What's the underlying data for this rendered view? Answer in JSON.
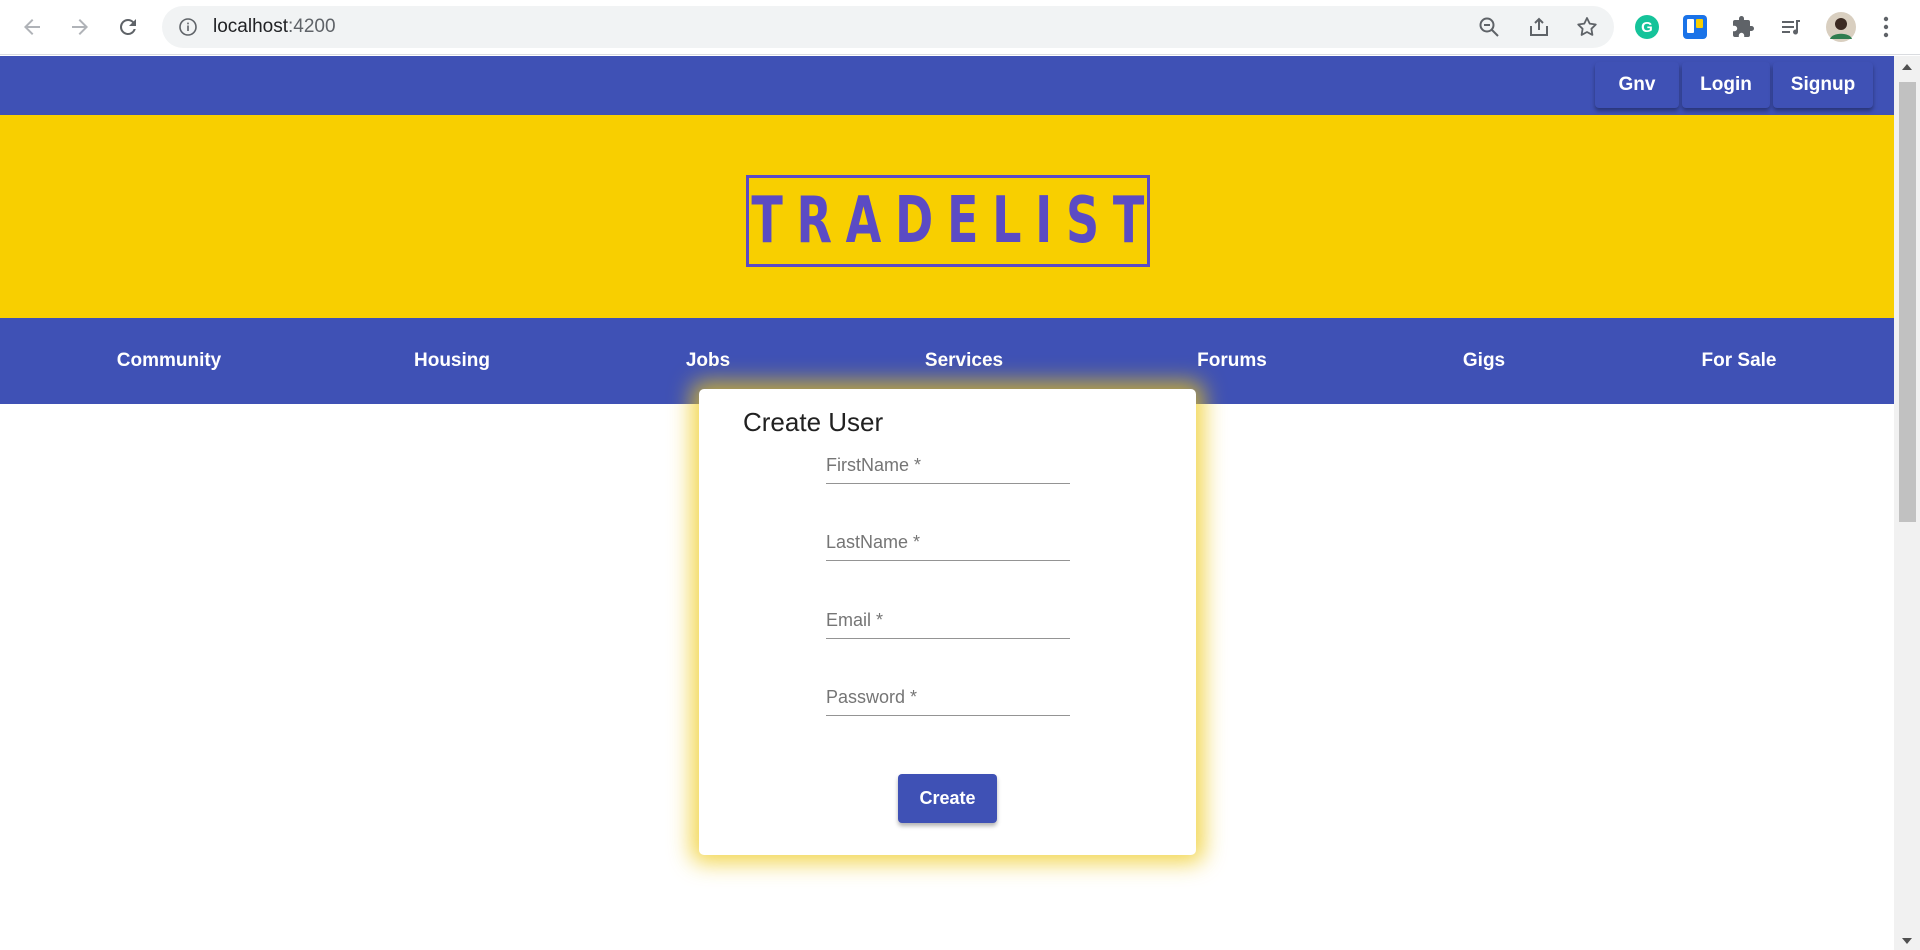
{
  "browser": {
    "url_host": "localhost",
    "url_port": ":4200"
  },
  "topbar": {
    "buttons": [
      "Gnv",
      "Login",
      "Signup"
    ]
  },
  "banner": {
    "logo_text": "TRADELIST"
  },
  "nav": {
    "items": [
      "Community",
      "Housing",
      "Jobs",
      "Services",
      "Forums",
      "Gigs",
      "For Sale"
    ]
  },
  "form": {
    "title": "Create User",
    "fields": [
      "FirstName *",
      "LastName *",
      "Email *",
      "Password *"
    ],
    "submit_label": "Create"
  },
  "colors": {
    "primary": "#3f51b5",
    "banner": "#f8cf00",
    "logo": "#5b4bc4"
  }
}
